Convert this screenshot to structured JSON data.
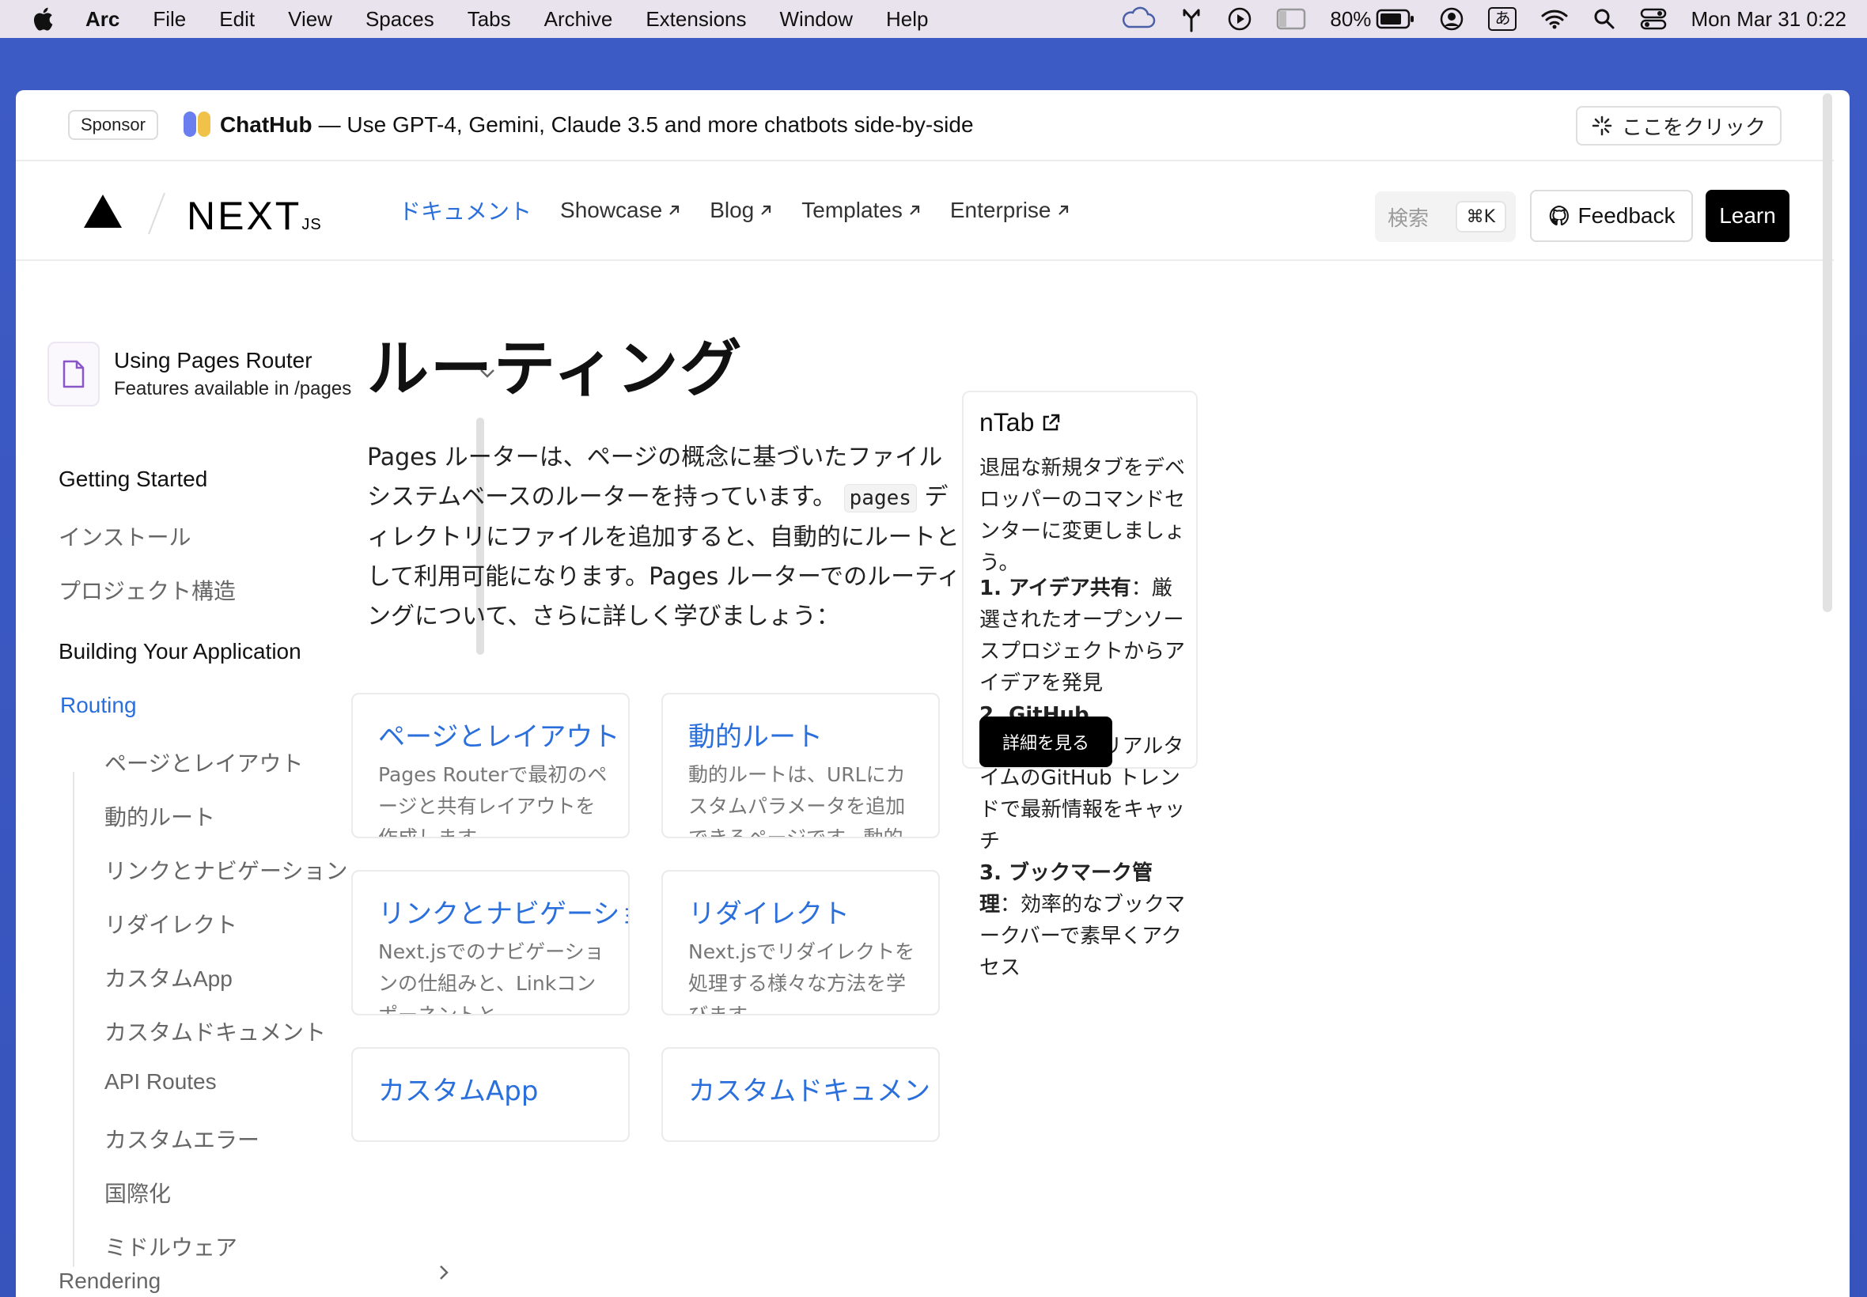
{
  "menubar": {
    "items": [
      "Arc",
      "File",
      "Edit",
      "View",
      "Spaces",
      "Tabs",
      "Archive",
      "Extensions",
      "Window",
      "Help"
    ],
    "battery": "80%",
    "ime": "あ",
    "clock": "Mon Mar 31  0:22"
  },
  "sponsor": {
    "badge": "Sponsor",
    "name": "ChatHub",
    "text": "— Use GPT-4, Gemini, Claude 3.5 and more chatbots side-by-side",
    "cta": "ここをクリック"
  },
  "header": {
    "logo_js": "JS",
    "nav": [
      "ドキュメント",
      "Showcase",
      "Blog",
      "Templates",
      "Enterprise"
    ],
    "search_placeholder": "検索",
    "search_kbd": "⌘K",
    "feedback": "Feedback",
    "learn": "Learn"
  },
  "sidebar": {
    "router_title": "Using Pages Router",
    "router_sub": "Features available in /pages",
    "getting_started": "Getting Started",
    "gs_items": [
      "インストール",
      "プロジェクト構造"
    ],
    "building": "Building Your Application",
    "routing": "Routing",
    "routing_items": [
      "ページとレイアウト",
      "動的ルート",
      "リンクとナビゲーション",
      "リダイレクト",
      "カスタムApp",
      "カスタムドキュメント",
      "API Routes",
      "カスタムエラー",
      "国際化",
      "ミドルウェア"
    ],
    "rendering": "Rendering"
  },
  "main": {
    "title": "ルーティング",
    "intro_before": "Pages ルーターは、ページの概念に基づいたファイルシステムベースのルーターを持っています。",
    "intro_code": "pages",
    "intro_after": " ディレクトリにファイルを追加すると、自動的にルートとして利用可能になります。Pages ルーターでのルーティングについて、さらに詳しく学びましょう：",
    "cards": [
      {
        "title": "ページとレイアウト",
        "desc": "Pages Routerで最初のページと共有レイアウトを作成します。"
      },
      {
        "title": "動的ルート",
        "desc": "動的ルートは、URLにカスタムパラメータを追加できるページです。動的ルートの作成方法につ…"
      },
      {
        "title": "リンクとナビゲーション",
        "desc": "Next.jsでのナビゲーションの仕組みと、Linkコンポーネントと`useRouter`フックの使用方法…"
      },
      {
        "title": "リダイレクト",
        "desc": "Next.jsでリダイレクトを処理する様々な方法を学びます。"
      },
      {
        "title": "カスタムApp",
        "desc": ""
      },
      {
        "title": "カスタムドキュメント",
        "desc": ""
      }
    ]
  },
  "ad": {
    "title": "nTab",
    "desc": "退屈な新規タブをデベロッパーのコマンドセンターに変更しましょう。",
    "items": [
      {
        "bold": "1. アイデア共有",
        "text": "：厳選されたオープンソースプロジェクトからアイデアを発見"
      },
      {
        "bold": "2. GitHub Trending",
        "text": "：リアルタイムのGitHub トレンドで最新情報をキャッチ"
      },
      {
        "bold": "3. ブックマーク管理",
        "text": "：効率的なブックマークバーで素早くアクセス"
      }
    ],
    "button": "詳細を見る"
  },
  "colors": {
    "accent": "#2a6fdb",
    "frame": "#3d5bc4"
  }
}
